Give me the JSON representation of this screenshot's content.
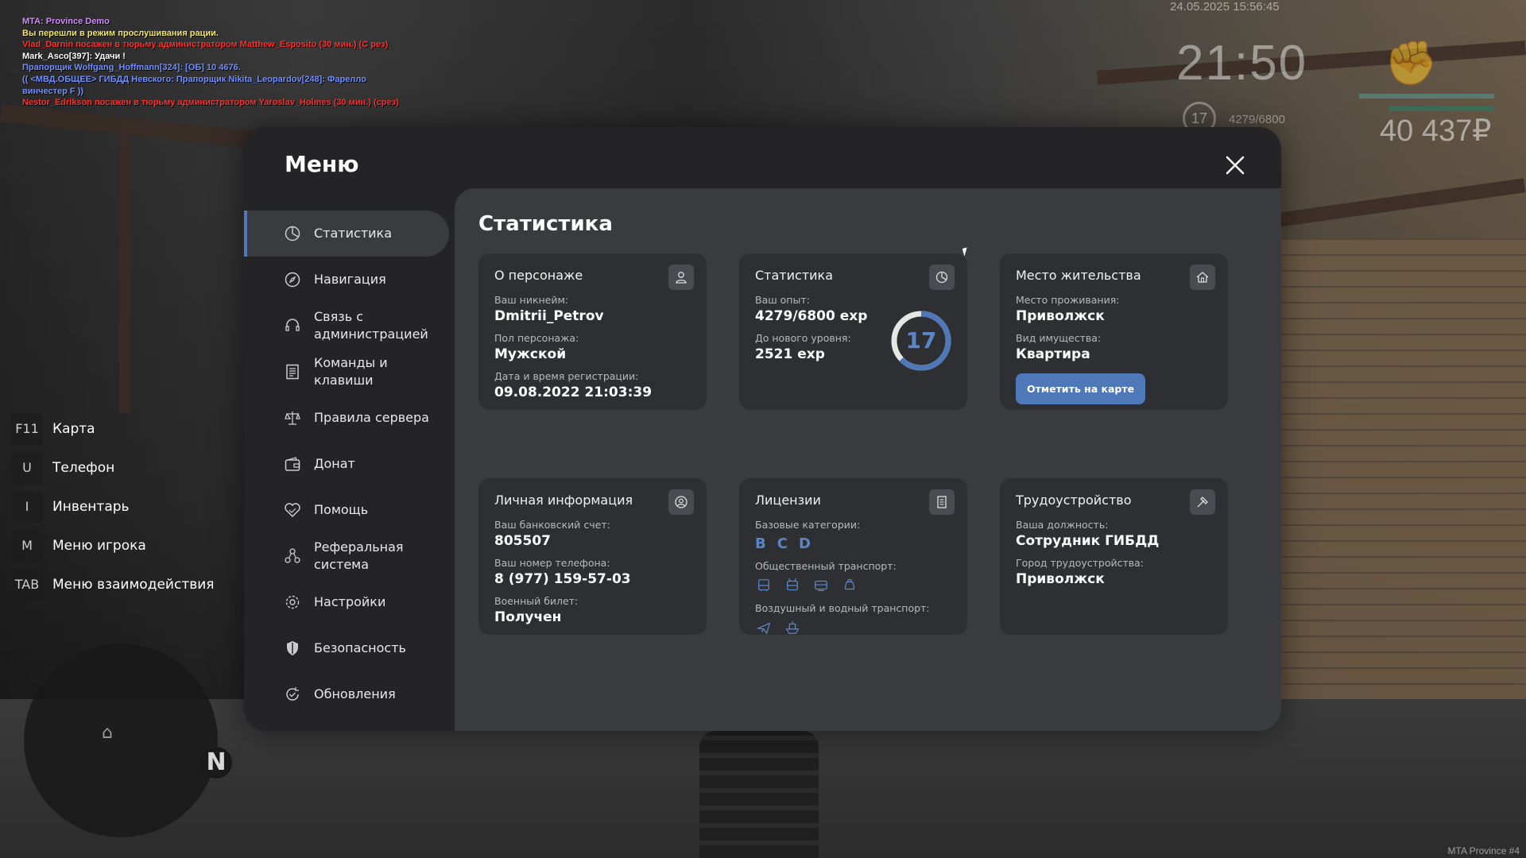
{
  "chat": [
    {
      "text": "MTA: Province Demo",
      "color": "#d38cff"
    },
    {
      "text": "Вы перешли в режим прослушивания рации.",
      "color": "#f5e663"
    },
    {
      "text": "Vlad_Darnin посажен в тюрьму администратором Matthew_Esposito (30 мин.) (С рез)",
      "color": "#ff3030"
    },
    {
      "text": "Mark_Asco[397]: Удачи !",
      "color": "#ffffff"
    },
    {
      "text": "Прапорщик Wolfgang_Hoffmann[324]: [ОБ] 10 4676.",
      "color": "#7090ff"
    },
    {
      "text": "(( <МВД.ОБЩЕЕ> ГИБДД Невского: Прапорщик Nikita_Leopardov[248]: Фарелло винчестер F ))",
      "color": "#7090ff"
    },
    {
      "text": "Nestor_Edrikson посажен в тюрьму администратором Yaroslav_Holmes (30 мин.) (срез)",
      "color": "#ff3030"
    }
  ],
  "hud": {
    "date": "24.05.2025 15:56:45",
    "time": "21:50",
    "level": "17",
    "exp": "4279/6800",
    "money": "40 437₽"
  },
  "hotkeys": [
    {
      "key": "F11",
      "label": "Карта"
    },
    {
      "key": "U",
      "label": "Телефон"
    },
    {
      "key": "I",
      "label": "Инвентарь"
    },
    {
      "key": "M",
      "label": "Меню игрока"
    },
    {
      "key": "TAB",
      "label": "Меню взаимодействия"
    }
  ],
  "radar": {
    "north": "N"
  },
  "watermark": "MTA Province #4",
  "menu": {
    "title": "Меню",
    "nav": [
      {
        "label": "Статистика",
        "icon": "pie-chart-icon"
      },
      {
        "label": "Навигация",
        "icon": "compass-icon"
      },
      {
        "label": "Связь с\nадминистрацией",
        "icon": "headset-icon"
      },
      {
        "label": "Команды и\nклавиши",
        "icon": "document-icon"
      },
      {
        "label": "Правила сервера",
        "icon": "scales-icon"
      },
      {
        "label": "Донат",
        "icon": "wallet-icon"
      },
      {
        "label": "Помощь",
        "icon": "handshake-heart-icon"
      },
      {
        "label": "Реферальная\nсистема",
        "icon": "people-network-icon"
      },
      {
        "label": "Настройки",
        "icon": "gear-icon"
      },
      {
        "label": "Безопасность",
        "icon": "shield-icon"
      },
      {
        "label": "Обновления",
        "icon": "refresh-check-icon"
      }
    ],
    "content_title": "Статистика",
    "cards": {
      "character": {
        "title": "О персонаже",
        "nick_label": "Ваш никнейм:",
        "nick": "Dmitrii_Petrov",
        "gender_label": "Пол персонажа:",
        "gender": "Мужской",
        "reg_label": "Дата и время регистрации:",
        "reg": "09.08.2022 21:03:39"
      },
      "stats": {
        "title": "Статистика",
        "exp_label": "Ваш опыт:",
        "exp": "4279/6800 exp",
        "next_label": "До нового уровня:",
        "next": "2521 exp",
        "level": "17",
        "level_progress": 0.63
      },
      "residence": {
        "title": "Место жительства",
        "place_label": "Место проживания:",
        "place": "Приволжск",
        "property_label": "Вид имущества:",
        "property": "Квартира",
        "button": "Отметить на карте"
      },
      "personal": {
        "title": "Личная информация",
        "bank_label": "Ваш банковский счет:",
        "bank": "805507",
        "phone_label": "Ваш номер телефона:",
        "phone": "8 (977) 159-57-03",
        "military_label": "Военный билет:",
        "military": "Получен"
      },
      "licenses": {
        "title": "Лицензии",
        "base_label": "Базовые категории:",
        "categories": [
          "B",
          "C",
          "D"
        ],
        "public_label": "Общественный транспорт:",
        "public_icons": [
          "bus-icon",
          "trolleybus-icon",
          "tram-icon",
          "taxi-icon"
        ],
        "air_label": "Воздушный и водный транспорт:",
        "air_icons": [
          "plane-icon",
          "boat-icon"
        ]
      },
      "job": {
        "title": "Трудоустройство",
        "position_label": "Ваша должность:",
        "position": "Сотрудник ГИБДД",
        "city_label": "Город трудоустройства:",
        "city": "Приволжск"
      }
    }
  }
}
